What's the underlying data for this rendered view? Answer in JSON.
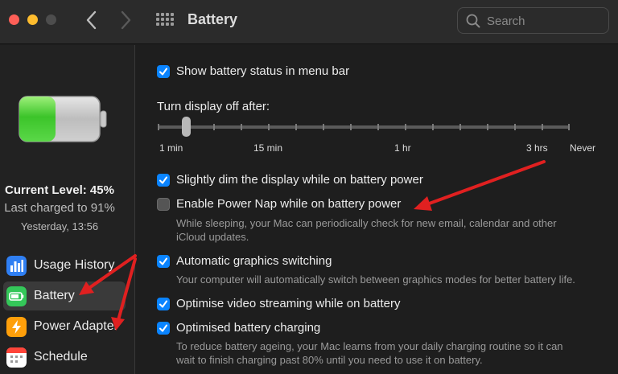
{
  "window": {
    "title": "Battery",
    "search_placeholder": "Search"
  },
  "sidebar": {
    "current_level": "Current Level: 45%",
    "last_charged": "Last charged to 91%",
    "charged_time": "Yesterday, 13:56",
    "items": [
      {
        "label": "Usage History",
        "icon": "usage-history-icon",
        "active": false
      },
      {
        "label": "Battery",
        "icon": "battery-icon",
        "active": true
      },
      {
        "label": "Power Adapter",
        "icon": "power-adapter-icon",
        "active": false
      },
      {
        "label": "Schedule",
        "icon": "schedule-icon",
        "active": false
      }
    ]
  },
  "battery_level": 0.45,
  "main": {
    "show_status": {
      "label": "Show battery status in menu bar",
      "checked": true
    },
    "display_off": {
      "title": "Turn display off after:",
      "value": "1 min",
      "ticks": [
        "1 min",
        "15 min",
        "1 hr",
        "3 hrs",
        "Never"
      ]
    },
    "dim_display": {
      "label": "Slightly dim the display while on battery power",
      "checked": true
    },
    "power_nap": {
      "label": "Enable Power Nap while on battery power",
      "checked": false,
      "desc_line1": "While sleeping, your Mac can periodically check for new email, calendar and other",
      "desc_line2": "iCloud updates."
    },
    "graphics_switching": {
      "label": "Automatic graphics switching",
      "checked": true,
      "desc": "Your computer will automatically switch between graphics modes for better battery life."
    },
    "video_streaming": {
      "label": "Optimise video streaming while on battery",
      "checked": true
    },
    "battery_charging": {
      "label": "Optimised battery charging",
      "checked": true,
      "desc_line1": "To reduce battery ageing, your Mac learns from your daily charging routine so it can",
      "desc_line2": "wait to finish charging past 80% until you need to use it on battery."
    }
  },
  "colors": {
    "accent": "#0a84ff",
    "battery_green": "#34c759",
    "annotation_arrow": "#e02020"
  }
}
